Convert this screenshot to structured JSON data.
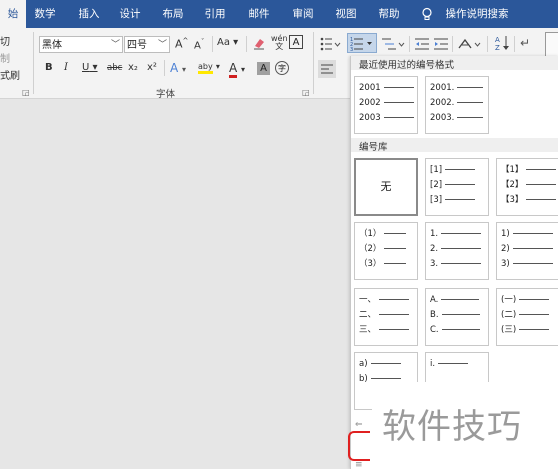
{
  "tabs": [
    {
      "label": "始"
    },
    {
      "label": "数学"
    },
    {
      "label": "插入"
    },
    {
      "label": "设计"
    },
    {
      "label": "布局"
    },
    {
      "label": "引用"
    },
    {
      "label": "邮件"
    },
    {
      "label": "审阅"
    },
    {
      "label": "视图"
    },
    {
      "label": "帮助"
    }
  ],
  "tell_me": "操作说明搜索",
  "clipboard": {
    "cut": "切",
    "copy": "制",
    "painter": "式刷"
  },
  "font": {
    "family": "黑体",
    "size": "四号",
    "group_label": "字体",
    "buttons": {
      "bold": "B",
      "italic": "I",
      "underline": "U",
      "strike": "abc",
      "sub": "x₂",
      "sup": "x²",
      "case": "Aa",
      "wen": "wén",
      "grow": "A",
      "shrink": "A",
      "clear": "A",
      "font_color": "A",
      "highlight": "aby",
      "shade": "A",
      "enclose": "字"
    }
  },
  "panel": {
    "recent_title": "最近使用过的编号格式",
    "library_title": "编号库",
    "recent": [
      {
        "lines": [
          "2001",
          "2002",
          "2003"
        ]
      },
      {
        "lines": [
          "2001.",
          "2002.",
          "2003."
        ]
      }
    ],
    "library": [
      {
        "none": "无"
      },
      {
        "lines": [
          "[1]",
          "[2]",
          "[3]"
        ]
      },
      {
        "lines": [
          "【1】",
          "【2】",
          "【3】"
        ]
      },
      {
        "lines": [
          "（1）",
          "（2）",
          "（3）"
        ]
      },
      {
        "lines": [
          "1.",
          "2.",
          "3."
        ]
      },
      {
        "lines": [
          "1)",
          "2)",
          "3)"
        ]
      },
      {
        "lines": [
          "一、",
          "二、",
          "三、"
        ]
      },
      {
        "lines": [
          "A.",
          "B.",
          "C."
        ]
      },
      {
        "lines": [
          "(一)",
          "(二)",
          "(三)"
        ]
      },
      {
        "lines": [
          "a)",
          "b)",
          ""
        ]
      },
      {
        "lines": [
          "i.",
          "",
          ""
        ]
      }
    ]
  },
  "watermark": "软件技巧"
}
